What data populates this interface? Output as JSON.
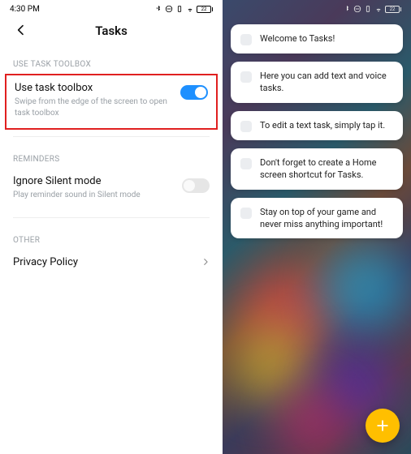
{
  "status": {
    "time": "4:30 PM",
    "battery": "22"
  },
  "header": {
    "title": "Tasks"
  },
  "sections": {
    "toolbox": {
      "label": "USE TASK TOOLBOX",
      "row_title": "Use task toolbox",
      "row_sub": "Swipe from the edge of the screen to open task toolbox"
    },
    "reminders": {
      "label": "REMINDERS",
      "row_title": "Ignore Silent mode",
      "row_sub": "Play reminder sound in Silent mode"
    },
    "other": {
      "label": "OTHER",
      "row_title": "Privacy Policy"
    }
  },
  "tasks": [
    {
      "text": "Welcome to Tasks!"
    },
    {
      "text": "Here you can add text and voice tasks."
    },
    {
      "text": "To edit a text task, simply tap it."
    },
    {
      "text": "Don't forget to create a Home screen shortcut for Tasks."
    },
    {
      "text": "Stay on top of your game and never miss anything important!"
    }
  ]
}
